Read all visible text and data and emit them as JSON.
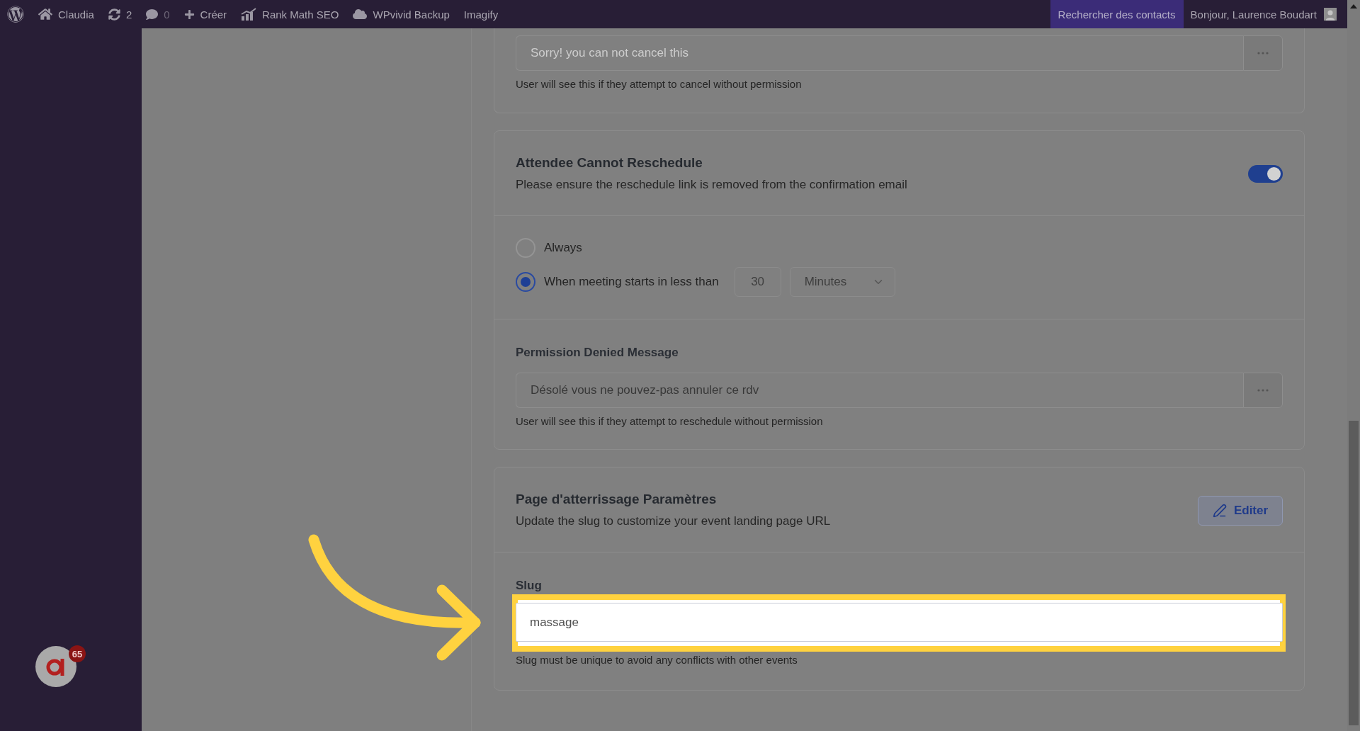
{
  "admin_bar": {
    "items": [
      {
        "kind": "logo"
      },
      {
        "kind": "site",
        "label": "Claudia"
      },
      {
        "kind": "updates",
        "label": "2"
      },
      {
        "kind": "comments",
        "label": "0"
      },
      {
        "kind": "new",
        "label": "Créer"
      },
      {
        "kind": "seo",
        "label": "Rank Math SEO"
      },
      {
        "kind": "backup",
        "label": "WPvivid Backup"
      },
      {
        "kind": "plain",
        "label": "Imagify"
      }
    ],
    "search_button": "Rechercher des contacts",
    "greeting": "Bonjour, Laurence Boudart"
  },
  "widget": {
    "badge": "65"
  },
  "cancel_message": {
    "placeholder": "Sorry! you can not cancel this",
    "hint": "User will see this if they attempt to cancel without permission"
  },
  "reschedule": {
    "title": "Attendee Cannot Reschedule",
    "description": "Please ensure the reschedule link is removed from the confirmation email",
    "on": true,
    "options": [
      {
        "label": "Always",
        "selected": false
      },
      {
        "label": "When meeting starts in less than",
        "selected": true,
        "amount": "30",
        "unit": "Minutes"
      }
    ],
    "message": {
      "label": "Permission Denied Message",
      "value": "Désolé vous ne pouvez-pas annuler ce rdv",
      "hint": "User will see this if they attempt to reschedule without permission"
    }
  },
  "landing_page": {
    "title": "Page d'atterrissage Paramètres",
    "description": "Update the slug to customize your event landing page URL",
    "edit_button": "Editer",
    "slug": {
      "label": "Slug",
      "value": "massage",
      "hint": "Slug must be unique to avoid any conflicts with other events",
      "highlighted": true
    }
  }
}
